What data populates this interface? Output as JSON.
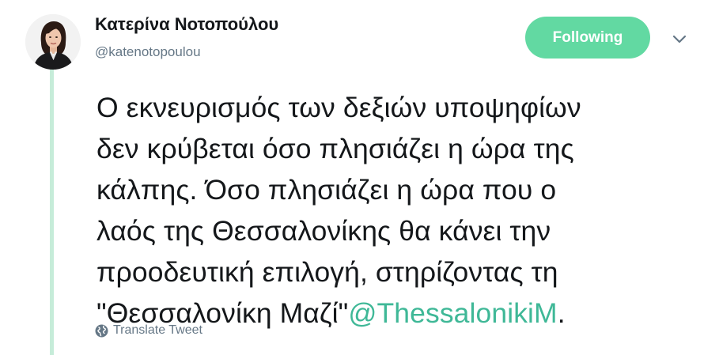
{
  "user": {
    "display_name": "Κατερίνα Νοτοπούλου",
    "screen_name": "@katenotopoulou"
  },
  "follow_button": {
    "label": "Following"
  },
  "tweet": {
    "lines": [
      "Ο εκνευρισμός των δεξιών υποψηφίων",
      "δεν κρύβεται όσο πλησιάζει η ώρα της",
      "κάλπης. Όσο πλησιάζει η ώρα που ο",
      "λαός της Θεσσαλονίκης θα κάνει την",
      "προοδευτική επιλογή, στηρίζοντας τη"
    ],
    "last_line_text": "\"Θεσσαλονίκη Μαζί\"",
    "mention": "@ThessalonikiM",
    "last_line_end": "."
  },
  "translate": {
    "label": "Translate Tweet"
  },
  "icons": {
    "avatar": "profile-photo",
    "caret": "chevron-down-icon",
    "translate": "globe-icon"
  },
  "colors": {
    "accent": "#62d9a2",
    "mention": "#3fb897",
    "thread_line": "#c6ecd9",
    "text": "#14171a",
    "muted": "#657786"
  }
}
